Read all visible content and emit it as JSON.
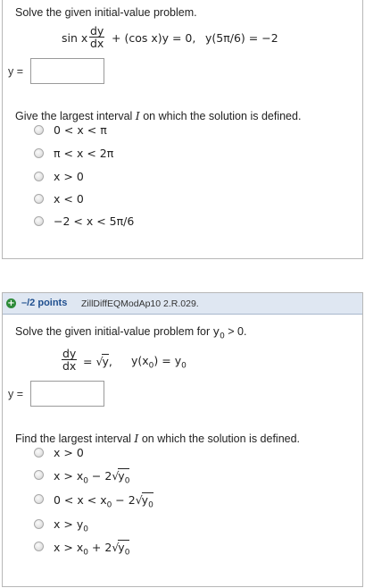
{
  "q1": {
    "prompt": "Solve the given initial-value problem.",
    "eq": {
      "prefix": "sin x",
      "frac_num": "dy",
      "frac_den": "dx",
      "suffix": "+ (cos x)y = 0,",
      "condition": "y(5π/6) = −2"
    },
    "y_label": "y =",
    "answer_value": "",
    "interval_prompt": "Give the largest interval I on which the solution is defined.",
    "interval_prompt_pre": "Give the largest interval ",
    "interval_prompt_var": "I",
    "interval_prompt_post": " on which the solution is defined.",
    "options": [
      "0 < x < π",
      "π < x < 2π",
      "x > 0",
      "x < 0",
      "−2 < x < 5π/6"
    ]
  },
  "q2": {
    "points": "–/2 points",
    "code": "ZillDiffEQModAp10 2.R.029.",
    "prompt_pre": "Solve the given initial-value problem for ",
    "prompt_var": "y",
    "prompt_sub": "0",
    "prompt_post": " > 0.",
    "eq": {
      "frac_num": "dy",
      "frac_den": "dx",
      "equals": "=",
      "sqrt_arg": "y",
      "comma": ",",
      "condition_pre": "y(x",
      "condition_sub0": "0",
      "condition_mid": ") = y",
      "condition_sub1": "0"
    },
    "y_label": "y =",
    "answer_value": "",
    "interval_prompt_pre": "Find the largest interval ",
    "interval_prompt_var": "I",
    "interval_prompt_post": " on which the solution is defined.",
    "options": [
      {
        "pre": "x > 0",
        "sqrt": ""
      },
      {
        "pre": "x > x",
        "sub": "0",
        "mid": " − 2",
        "sqrt": "y",
        "sqrt_sub": "0"
      },
      {
        "pre": "0 < x < x",
        "sub": "0",
        "mid": " − 2",
        "sqrt": "y",
        "sqrt_sub": "0"
      },
      {
        "pre": "x > y",
        "sub": "0",
        "mid": "",
        "sqrt": ""
      },
      {
        "pre": "x > x",
        "sub": "0",
        "mid": " + 2",
        "sqrt": "y",
        "sqrt_sub": "0"
      }
    ]
  }
}
